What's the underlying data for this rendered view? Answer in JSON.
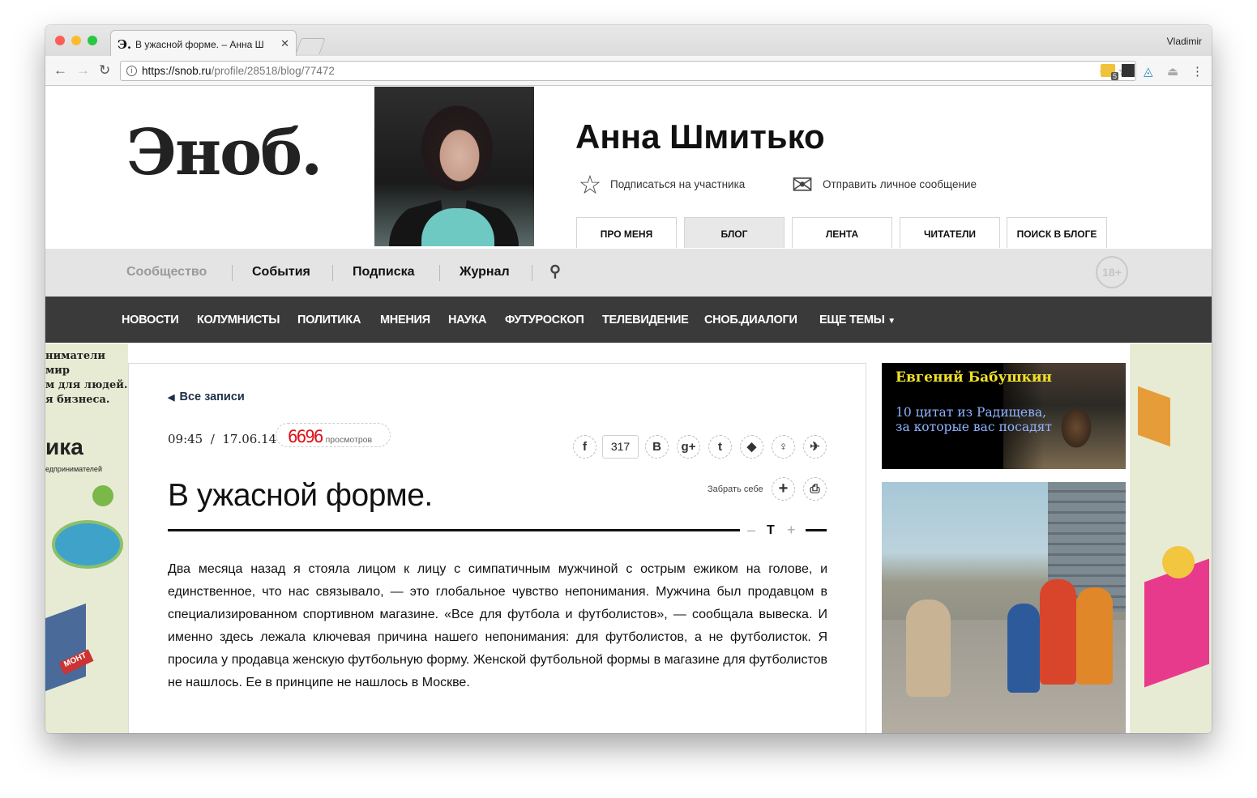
{
  "browser": {
    "tab_title": "В ужасной форме. – Анна Ш",
    "tab_favicon": "Э.",
    "user": "Vladimir",
    "url_host": "https://snob.ru",
    "url_path": "/profile/28518/blog/77472",
    "ext_badge": "5"
  },
  "header": {
    "logo": "Эноб.",
    "profile_name": "Анна Шмитько",
    "subscribe": "Подписаться на участника",
    "message": "Отправить личное сообщение",
    "tabs": [
      "ПРО МЕНЯ",
      "БЛОГ",
      "ЛЕНТА",
      "ЧИТАТЕЛИ",
      "ПОИСК В БЛОГЕ"
    ],
    "active_tab": "БЛОГ"
  },
  "topnav": {
    "items": [
      "Сообщество",
      "События",
      "Подписка",
      "Журнал"
    ],
    "age": "18+"
  },
  "sections": [
    "НОВОСТИ",
    "КОЛУМНИСТЫ",
    "ПОЛИТИКА",
    "МНЕНИЯ",
    "НАУКА",
    "ФУТУРОСКОП",
    "ТЕЛЕВИДЕНИЕ",
    "СНОБ.ДИАЛОГИ",
    "ЕЩЕ ТЕМЫ"
  ],
  "side_banner": {
    "lines": [
      "ниматели",
      "мир",
      "м для людей.",
      "я бизнеса."
    ],
    "brand": "ика",
    "sub": "едпринимателей",
    "sign": "МОНТ"
  },
  "article": {
    "back": "Все записи",
    "time": "09:45",
    "date": "17.06.14",
    "views": "6696",
    "views_label": "просмотров",
    "share_count": "317",
    "save_label": "Забрать себе",
    "title": "В ужасной форме.",
    "font_size_label": "Т",
    "body": "Два месяца назад я стояла лицом к лицу с симпатичным мужчиной с острым ежиком на голове, и единственное, что нас связывало, — это глобальное чувство непонимания. Мужчина был продавцом в специализированном спортивном магазине. «Все для футбола и футболистов», — сообщала вывеска. И именно здесь лежала ключевая причина нашего непонимания: для футболистов, а не футболисток. Я просила у продавца женскую футбольную форму. Женской футбольной формы в магазине для футболистов не нашлось. Ее в принципе не нашлось в Москве."
  },
  "promo": {
    "author": "Евгений Бабушкин",
    "text": "10 цитат из Радищева, за которые вас посадят"
  },
  "colors": {
    "views_red": "#e0121a",
    "promo_yellow": "#f2e32a",
    "promo_blue": "#8fb3ff",
    "dark_nav": "#3a3a3a"
  }
}
